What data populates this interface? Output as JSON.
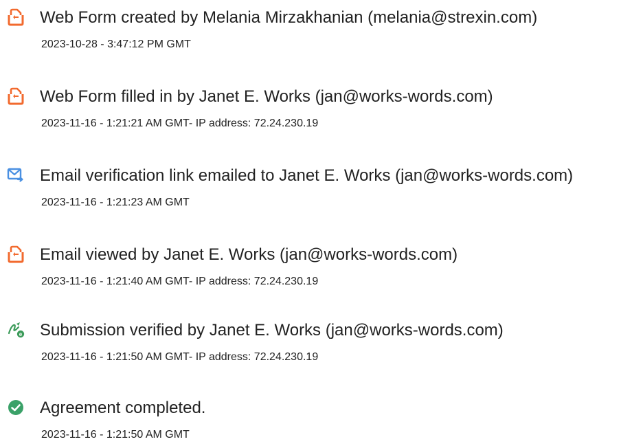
{
  "events": [
    {
      "icon": "document-action-icon",
      "title": "Web Form created by Melania Mirzakhanian (melania@strexin.com)",
      "meta": "2023-10-28 - 3:47:12 PM GMT"
    },
    {
      "icon": "document-action-icon",
      "title": "Web Form filled in by Janet E. Works (jan@works-words.com)",
      "meta": "2023-11-16 - 1:21:21 AM GMT- IP address: 72.24.230.19"
    },
    {
      "icon": "email-sent-icon",
      "title": "Email verification link emailed to Janet E. Works (jan@works-words.com)",
      "meta": "2023-11-16 - 1:21:23 AM GMT"
    },
    {
      "icon": "document-action-icon",
      "title": "Email viewed by Janet E. Works (jan@works-words.com)",
      "meta": "2023-11-16 - 1:21:40 AM GMT- IP address: 72.24.230.19"
    },
    {
      "icon": "signature-verified-icon",
      "title": "Submission verified by Janet E. Works (jan@works-words.com)",
      "meta": "2023-11-16 - 1:21:50 AM GMT- IP address: 72.24.230.19"
    },
    {
      "icon": "check-circle-icon",
      "title": "Agreement completed.",
      "meta": "2023-11-16 - 1:21:50 AM GMT"
    }
  ],
  "colors": {
    "document_icon": "#f26a2e",
    "email_icon": "#4a90e2",
    "signature_icon": "#3c9b5a",
    "check_icon": "#3aa168",
    "text": "#222222"
  }
}
